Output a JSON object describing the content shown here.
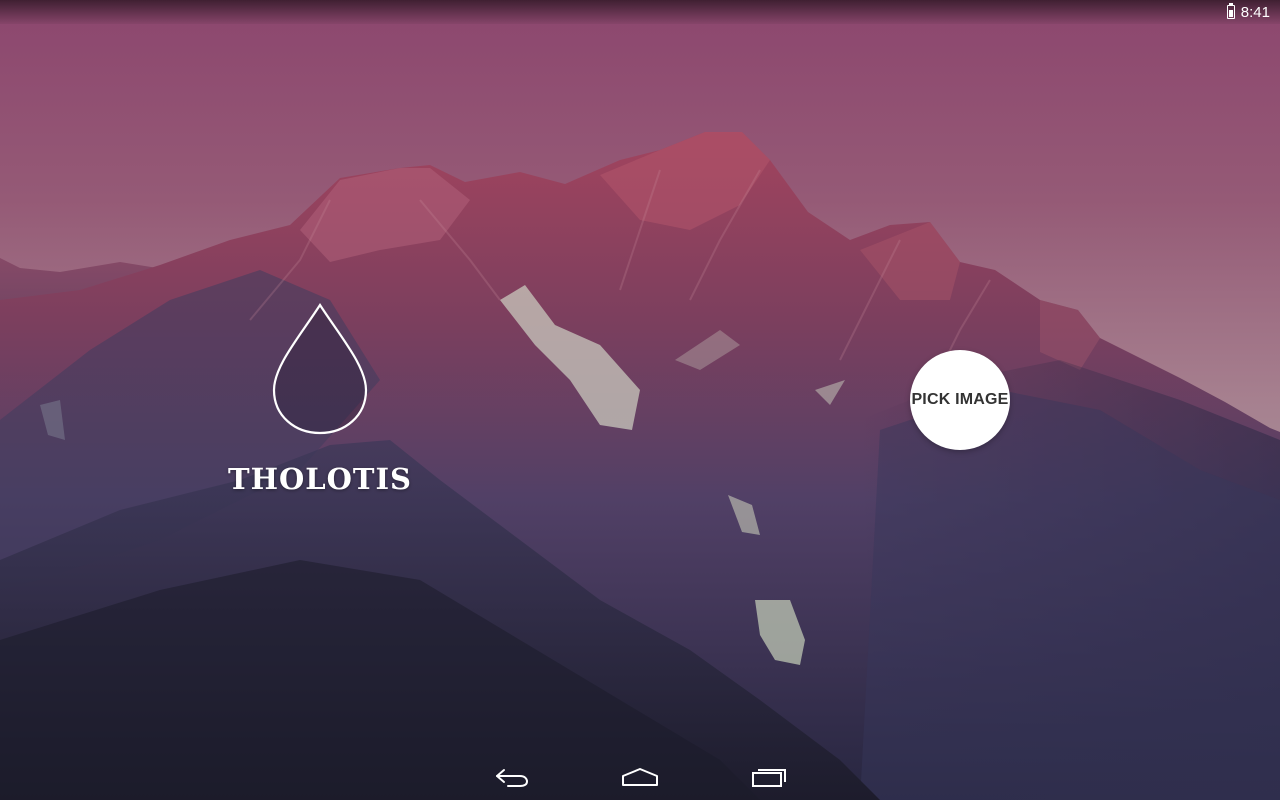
{
  "status_bar": {
    "time": "8:41",
    "battery_icon": "battery-icon"
  },
  "app": {
    "title": "THOLOTIS",
    "logo_icon": "water-drop-icon"
  },
  "actions": {
    "pick_image_label": "PICK IMAGE"
  },
  "nav_bar": {
    "back_icon": "back-icon",
    "home_icon": "home-icon",
    "recents_icon": "recents-icon"
  },
  "colors": {
    "sky_top": "#8f4b72",
    "sky_bottom": "#b08a9a",
    "mountain_shadow": "#2f2c4a",
    "button_bg": "#ffffff",
    "button_text": "#333333"
  }
}
